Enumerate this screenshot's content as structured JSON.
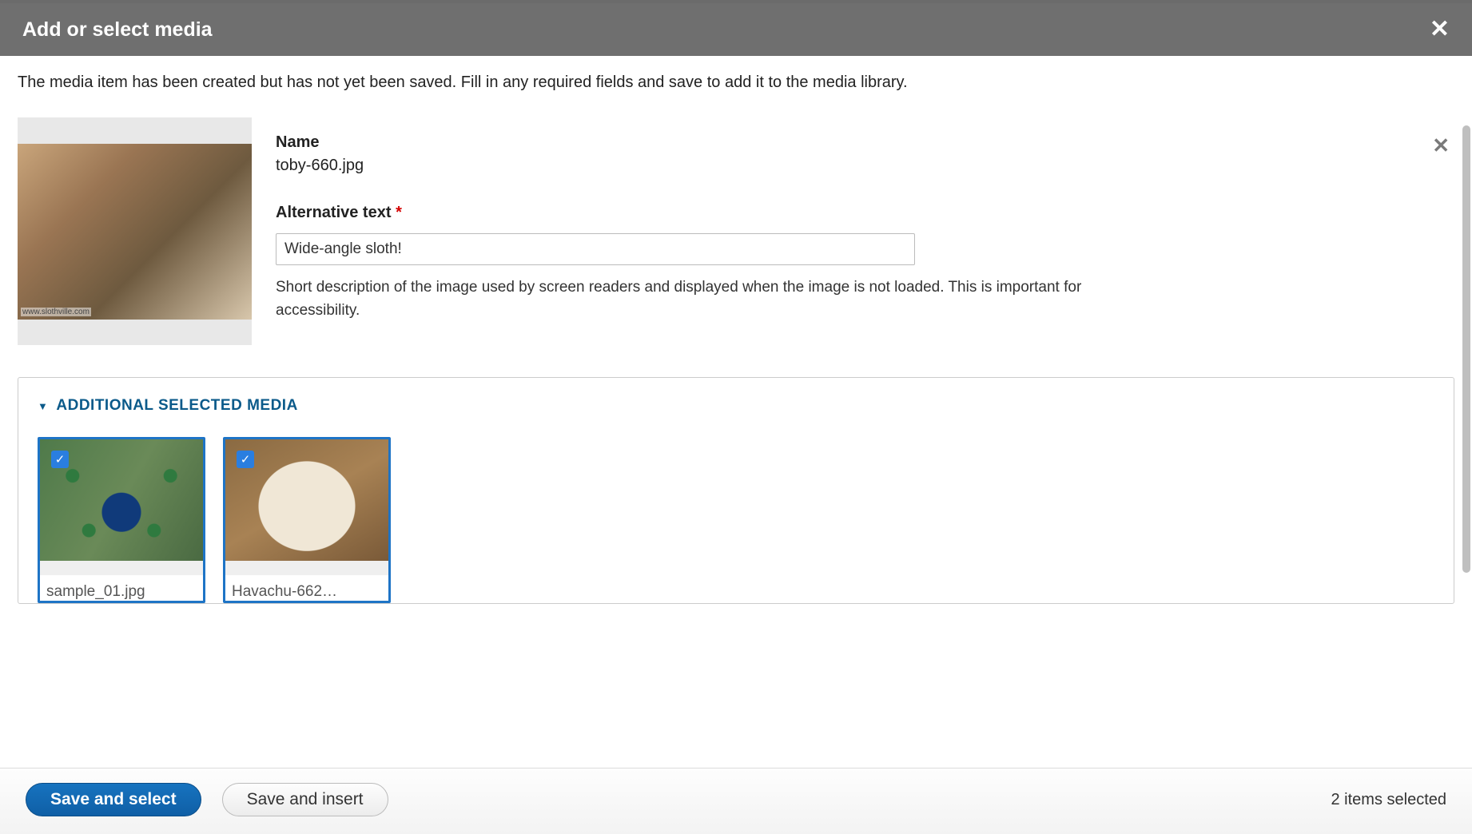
{
  "dialog": {
    "title": "Add or select media",
    "intro": "The media item has been created but has not yet been saved. Fill in any required fields and save to add it to the media library."
  },
  "media": {
    "name_label": "Name",
    "name_value": "toby-660.jpg",
    "alt_label": "Alternative text",
    "required_marker": "*",
    "alt_value": "Wide-angle sloth!",
    "alt_help": "Short description of the image used by screen readers and displayed when the image is not loaded. This is important for accessibility."
  },
  "additional": {
    "heading": "ADDITIONAL SELECTED MEDIA",
    "items": [
      {
        "label": "sample_01.jpg",
        "checked": true
      },
      {
        "label": "Havachu-662…",
        "checked": true
      }
    ]
  },
  "footer": {
    "save_select": "Save and select",
    "save_insert": "Save and insert",
    "status": "2 items selected"
  }
}
